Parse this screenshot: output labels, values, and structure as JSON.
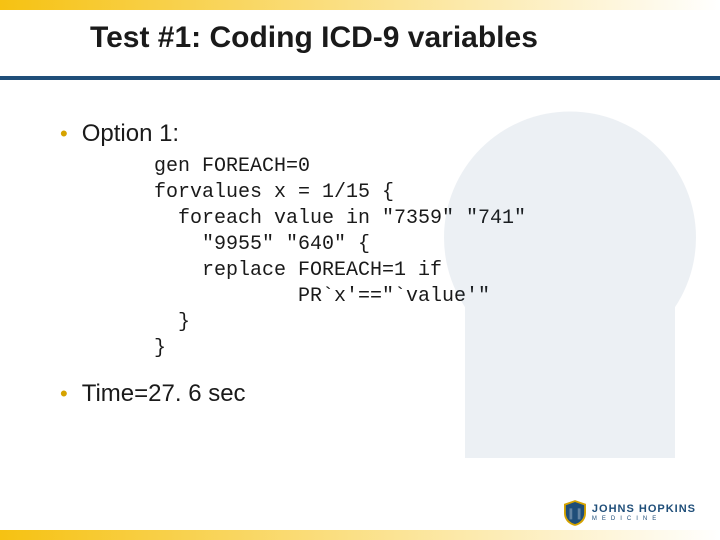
{
  "title": "Test #1: Coding ICD-9 variables",
  "bullets": {
    "option_label": "Option 1:",
    "time_label": "Time=27. 6 sec"
  },
  "code": "gen FOREACH=0\nforvalues x = 1/15 {\n  foreach value in \"7359\" \"741\"\n    \"9955\" \"640\" {\n    replace FOREACH=1 if\n            PR`x'==\"`value'\"\n  }\n}",
  "brand": {
    "name": "JOHNS HOPKINS",
    "sub": "MEDICINE"
  }
}
